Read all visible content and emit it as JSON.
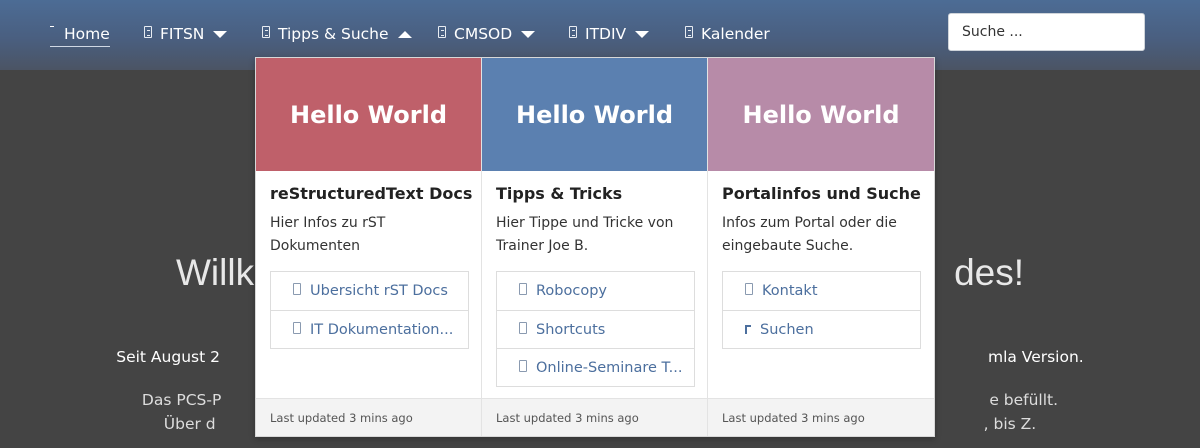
{
  "nav": {
    "home": "Home",
    "items": [
      {
        "label": "FITSN",
        "expanded": false
      },
      {
        "label": "Tipps & Suche",
        "expanded": true
      },
      {
        "label": "CMSOD",
        "expanded": false
      },
      {
        "label": "ITDIV",
        "expanded": false
      },
      {
        "label": "Kalender"
      }
    ],
    "search_placeholder": "Suche ..."
  },
  "background": {
    "heading_left": "Willk",
    "heading_right": "des!",
    "line1_left": "Seit August 2",
    "line1_right": "mla Version.",
    "line2a_left": "Das PCS-P",
    "line2a_right": "e befüllt.",
    "line2b_left": "Über d",
    "line2b_right": ", bis Z."
  },
  "colors": {
    "card1": "#bf606a",
    "card2": "#5b80b0",
    "card3": "#b78ba8",
    "link": "#4c6f9e"
  },
  "cards": [
    {
      "banner": "Hello World",
      "title": "reStructuredText Docs",
      "desc": "Hier Infos zu rST Dokumenten",
      "links": [
        {
          "label": "Übersicht rST Docs",
          "icon": "document-icon"
        },
        {
          "label": "IT Dokumentation...",
          "icon": "document-icon"
        }
      ],
      "footer": "Last updated 3 mins ago"
    },
    {
      "banner": "Hello World",
      "title": "Tipps & Tricks",
      "desc": "Hier Tippe und Tricke von Trainer Joe B.",
      "links": [
        {
          "label": "Robocopy",
          "icon": "document-icon"
        },
        {
          "label": "Shortcuts",
          "icon": "document-icon"
        },
        {
          "label": "Online-Seminare T...",
          "icon": "document-icon"
        }
      ],
      "footer": "Last updated 3 mins ago"
    },
    {
      "banner": "Hello World",
      "title": "Portalinfos und Suche",
      "desc": "Infos zum Portal oder die eingebaute Suche.",
      "links": [
        {
          "label": "Kontakt",
          "icon": "document-icon"
        },
        {
          "label": "Suchen",
          "icon": "search-icon"
        }
      ],
      "footer": "Last updated 3 mins ago"
    }
  ]
}
